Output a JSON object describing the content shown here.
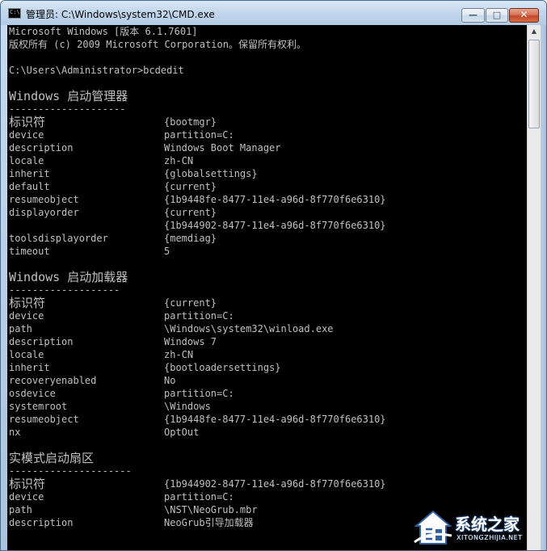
{
  "window": {
    "title": "管理员: C:\\Windows\\system32\\CMD.exe",
    "icon_label": "C:\\",
    "buttons": {
      "minimize": "—",
      "maximize": "□",
      "close": "✕"
    }
  },
  "console": {
    "header": [
      "Microsoft Windows [版本 6.1.7601]",
      "版权所有 (c) 2009 Microsoft Corporation。保留所有权利。"
    ],
    "prompt": "C:\\Users\\Administrator>bcdedit",
    "sections": [
      {
        "heading": "Windows 启动管理器",
        "rule": "--------------------",
        "rows": [
          {
            "key": "标识符",
            "value": "{bootmgr}"
          },
          {
            "key": "device",
            "value": "partition=C:"
          },
          {
            "key": "description",
            "value": "Windows Boot Manager"
          },
          {
            "key": "locale",
            "value": "zh-CN"
          },
          {
            "key": "inherit",
            "value": "{globalsettings}"
          },
          {
            "key": "default",
            "value": "{current}"
          },
          {
            "key": "resumeobject",
            "value": "{1b9448fe-8477-11e4-a96d-8f770f6e6310}"
          },
          {
            "key": "displayorder",
            "value": "{current}"
          },
          {
            "key": "",
            "value": "{1b944902-8477-11e4-a96d-8f770f6e6310}"
          },
          {
            "key": "toolsdisplayorder",
            "value": "{memdiag}"
          },
          {
            "key": "timeout",
            "value": "5"
          }
        ]
      },
      {
        "heading": "Windows 启动加载器",
        "rule": "-------------------",
        "rows": [
          {
            "key": "标识符",
            "value": "{current}"
          },
          {
            "key": "device",
            "value": "partition=C:"
          },
          {
            "key": "path",
            "value": "\\Windows\\system32\\winload.exe"
          },
          {
            "key": "description",
            "value": "Windows 7"
          },
          {
            "key": "locale",
            "value": "zh-CN"
          },
          {
            "key": "inherit",
            "value": "{bootloadersettings}"
          },
          {
            "key": "recoveryenabled",
            "value": "No"
          },
          {
            "key": "osdevice",
            "value": "partition=C:"
          },
          {
            "key": "systemroot",
            "value": "\\Windows"
          },
          {
            "key": "resumeobject",
            "value": "{1b9448fe-8477-11e4-a96d-8f770f6e6310}"
          },
          {
            "key": "nx",
            "value": "OptOut"
          }
        ]
      },
      {
        "heading": "实模式启动扇区",
        "rule": "---------------------",
        "rows": [
          {
            "key": "标识符",
            "value": "{1b944902-8477-11e4-a96d-8f770f6e6310}"
          },
          {
            "key": "device",
            "value": "partition=C:"
          },
          {
            "key": "path",
            "value": "\\NST\\NeoGrub.mbr"
          },
          {
            "key": "description",
            "value": "NeoGrub引导加载器"
          }
        ]
      }
    ]
  },
  "scrollbar": {
    "up_arrow": "▲"
  },
  "watermark": {
    "text": "系统之家",
    "sub": "XITONGZHIJIA.NET"
  }
}
